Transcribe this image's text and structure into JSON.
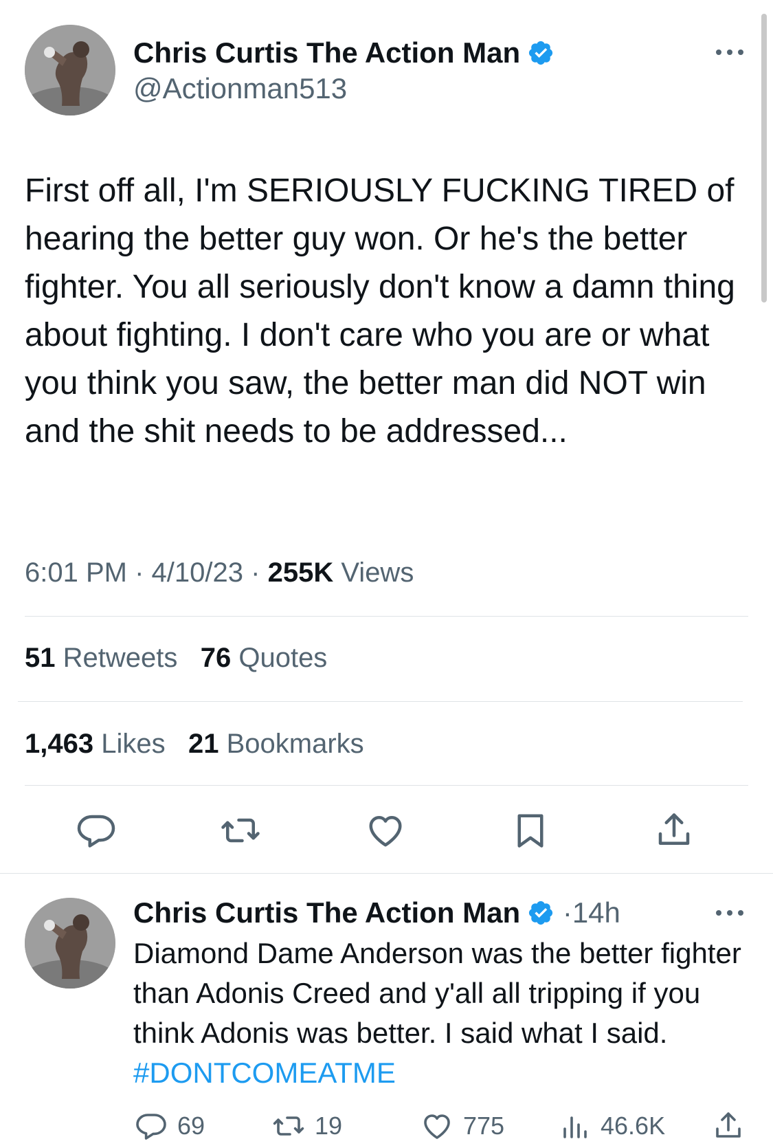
{
  "tweet": {
    "author_name": "Chris Curtis The Action Man",
    "handle": "@Actionman513",
    "text": "First off all, I'm SERIOUSLY FUCKING TIRED of hearing the better guy won. Or he's the better fighter.  You all seriously don't know a damn thing about fighting. I don't care who you are or what you think you saw, the better man did NOT win and the shit needs to be addressed...",
    "time": "6:01 PM",
    "sep": "·",
    "date": "4/10/23",
    "views_count": "255K",
    "views_label": "Views",
    "retweets_count": "51",
    "retweets_label": "Retweets",
    "quotes_count": "76",
    "quotes_label": "Quotes",
    "likes_count": "1,463",
    "likes_label": "Likes",
    "bookmarks_count": "21",
    "bookmarks_label": "Bookmarks"
  },
  "reply": {
    "author_name": "Chris Curtis The Action Man",
    "sep": "·",
    "age": "14h",
    "text": "Diamond Dame Anderson was the better fighter than Adonis Creed and y'all all tripping if you think Adonis was better. I said what I said.",
    "hashtag": "#DONTCOMEATME",
    "replies": "69",
    "retweets": "19",
    "likes": "775",
    "views": "46.6K"
  },
  "icons": {
    "verified": "verified-badge-icon",
    "more": "more-options-icon",
    "reply": "reply-icon",
    "retweet": "retweet-icon",
    "like": "heart-icon",
    "bookmark": "bookmark-icon",
    "share": "share-icon",
    "views": "views-icon"
  },
  "colors": {
    "accent": "#1d9bf0",
    "text": "#0f1419",
    "secondary": "#536471"
  }
}
